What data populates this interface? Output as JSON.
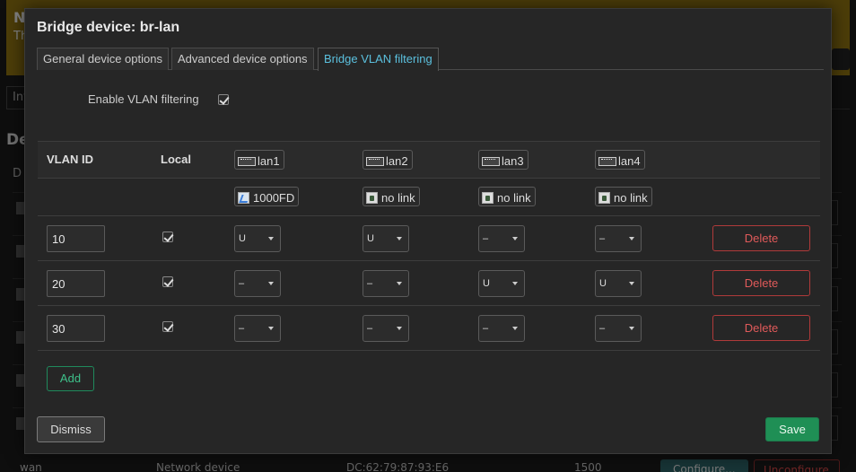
{
  "background": {
    "notice_title": "N",
    "notice_text": "Th",
    "tab_label": "Int",
    "section_title": "De",
    "column_label": "D",
    "row_partial": "wan",
    "row_type": "Network device",
    "row_mac": "DC:62:79:87:93:E6",
    "row_mtu": "1500",
    "configure_label": "Configure...",
    "unconfigure_label": "Unconfigure"
  },
  "modal": {
    "title": "Bridge device: br-lan",
    "tabs": [
      {
        "label": "General device options",
        "active": false
      },
      {
        "label": "Advanced device options",
        "active": false
      },
      {
        "label": "Bridge VLAN filtering",
        "active": true
      }
    ],
    "enable_label": "Enable VLAN filtering",
    "enable_checked": true,
    "table": {
      "col_vlan_id": "VLAN ID",
      "col_local": "Local",
      "ports": [
        {
          "name": "lan1",
          "status": "1000FD",
          "status_icon": "link-up-icon"
        },
        {
          "name": "lan2",
          "status": "no link",
          "status_icon": "no-link-icon"
        },
        {
          "name": "lan3",
          "status": "no link",
          "status_icon": "no-link-icon"
        },
        {
          "name": "lan4",
          "status": "no link",
          "status_icon": "no-link-icon"
        }
      ],
      "rows": [
        {
          "vlan_id": "10",
          "local": true,
          "ports": [
            "U",
            "U",
            "–",
            "–"
          ]
        },
        {
          "vlan_id": "20",
          "local": true,
          "ports": [
            "–",
            "–",
            "U",
            "U"
          ]
        },
        {
          "vlan_id": "30",
          "local": true,
          "ports": [
            "–",
            "–",
            "–",
            "–"
          ]
        }
      ],
      "delete_label": "Delete"
    },
    "add_label": "Add",
    "dismiss_label": "Dismiss",
    "save_label": "Save"
  },
  "colors": {
    "accent_tab": "#5bc0de",
    "delete": "#e05a5a",
    "save_bg": "#1f8f55",
    "add": "#3ec08a"
  }
}
